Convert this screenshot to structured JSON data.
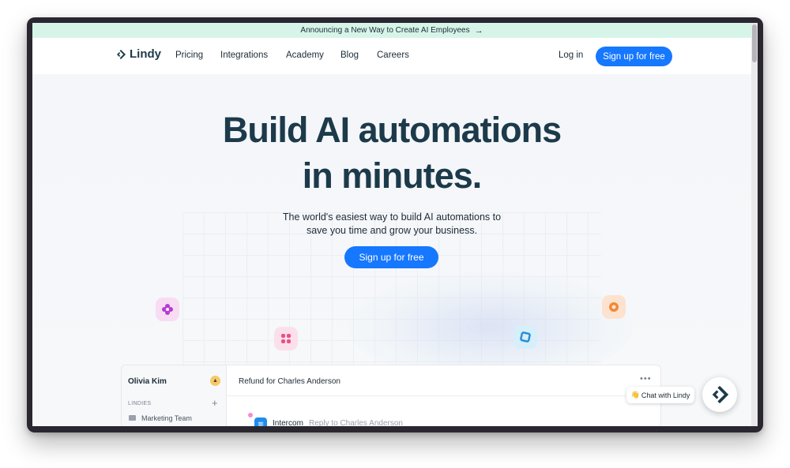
{
  "announcement": {
    "text": "Announcing a New Way to Create AI Employees",
    "arrow": "→"
  },
  "nav": {
    "logo": "Lindy",
    "links": [
      "Pricing",
      "Integrations",
      "Academy",
      "Blog",
      "Careers"
    ],
    "login": "Log in",
    "signup": "Sign up for free"
  },
  "hero": {
    "title_line1": "Build AI automations",
    "title_line2": "in minutes.",
    "subtitle_line1": "The world's easiest way to build AI automations to",
    "subtitle_line2": "save you time and grow your business.",
    "cta": "Sign up for free"
  },
  "app_preview": {
    "user_name": "Olivia Kim",
    "section_label": "LINDIES",
    "folder": "Marketing Team",
    "thread_title": "Refund for Charles Anderson",
    "more": "•••",
    "integration": "Intercom",
    "action": "Reply to Charles Anderson"
  },
  "chat_widget": {
    "emoji": "👋",
    "label": "Chat with Lindy"
  },
  "colors": {
    "brand_blue": "#1677ff",
    "heading": "#1c3a4a",
    "announce_bg": "#d6f5e8"
  },
  "icons": [
    "lindy-logo-icon",
    "arrow-right-icon",
    "purple-flower-icon",
    "pink-clover-icon",
    "blue-square-icon",
    "orange-flower-icon",
    "folder-icon",
    "plus-icon",
    "intercom-icon",
    "lindy-launcher-icon"
  ]
}
